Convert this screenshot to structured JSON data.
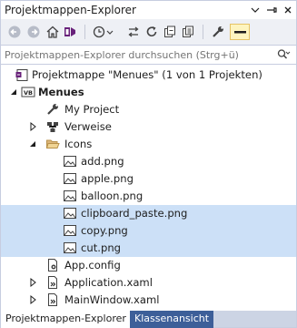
{
  "window": {
    "title": "Projektmappen-Explorer"
  },
  "search": {
    "placeholder": "Projektmappen-Explorer durchsuchen (Strg+ü)"
  },
  "tree": {
    "solution": "Projektmappe \"Menues\" (1 von 1 Projekten)",
    "project": "Menues",
    "items": {
      "my_project": "My Project",
      "references": "Verweise",
      "icons_folder": "Icons",
      "add": "add.png",
      "apple": "apple.png",
      "balloon": "balloon.png",
      "clipboard_paste": "clipboard_paste.png",
      "copy": "copy.png",
      "cut": "cut.png",
      "app_config": "App.config",
      "application_xaml": "Application.xaml",
      "mainwindow_xaml": "MainWindow.xaml"
    }
  },
  "tabs": {
    "explorer": "Projektmappen-Explorer",
    "class_view": "Klassenansicht"
  },
  "colors": {
    "selection": "#cce0f7",
    "active_tab_bg": "#ffffff",
    "inactive_tab_bg": "#3d5f99",
    "toolbar_bg": "#eef0f5"
  }
}
